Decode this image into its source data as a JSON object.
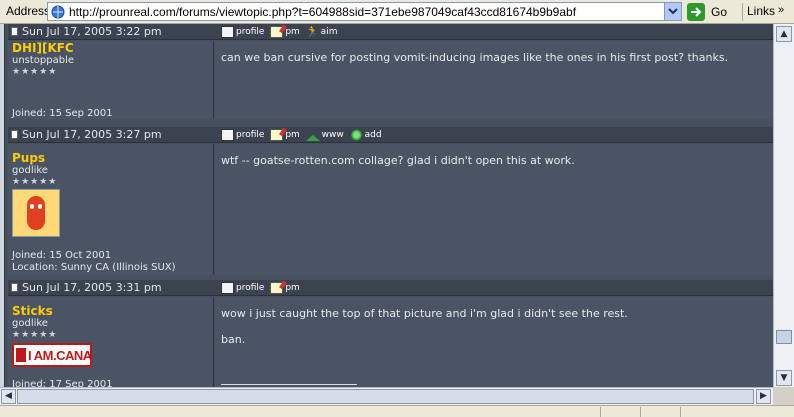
{
  "address_bar": {
    "label": "Address",
    "url": "http://prounreal.com/forums/viewtopic.php?t=604988sid=371ebe987049caf43ccd81674b9b9abf",
    "go_label": "Go",
    "links_label": "Links",
    "chevron": "»"
  },
  "posts": [
    {
      "date": "Sun Jul 17, 2005 3:22 pm",
      "username": "DHI][KFC",
      "rank": "unstoppable",
      "stars": "★★★★★",
      "joined": "Joined: 15 Sep 2001",
      "location": "",
      "actions": [
        {
          "icon": "profile-icon",
          "label": "profile"
        },
        {
          "icon": "pm-icon",
          "label": "pm"
        },
        {
          "icon": "aim-icon",
          "label": "aim"
        }
      ],
      "message_lines": [
        "can we ban cursive for posting vomit-inducing images like the ones in his first post? thanks."
      ]
    },
    {
      "date": "Sun Jul 17, 2005 3:27 pm",
      "username": "Pups",
      "rank": "godlike",
      "stars": "★★★★★",
      "joined": "Joined: 15 Oct 2001",
      "location": "Location: Sunny CA (Illinois SUX)",
      "actions": [
        {
          "icon": "profile-icon",
          "label": "profile"
        },
        {
          "icon": "pm-icon",
          "label": "pm"
        },
        {
          "icon": "www-icon",
          "label": "www"
        },
        {
          "icon": "add-icon",
          "label": "add"
        }
      ],
      "message_lines": [
        "wtf -- goatse-rotten.com collage? glad i didn't open this at work."
      ]
    },
    {
      "date": "Sun Jul 17, 2005 3:31 pm",
      "username": "Sticks",
      "rank": "godlike",
      "stars": "★★★★★",
      "joined": "Joined: 17 Sep 2001",
      "location": "",
      "badge_text": "I AM.CANADIAN",
      "actions": [
        {
          "icon": "profile-icon",
          "label": "profile"
        },
        {
          "icon": "pm-icon",
          "label": "pm"
        }
      ],
      "message_lines": [
        "wow i just caught the top of that picture and i'm glad i didn't see the rest.",
        "ban."
      ]
    }
  ],
  "scrollbar": {
    "up": "▲",
    "down": "▼",
    "left": "◀",
    "right": "▶"
  }
}
